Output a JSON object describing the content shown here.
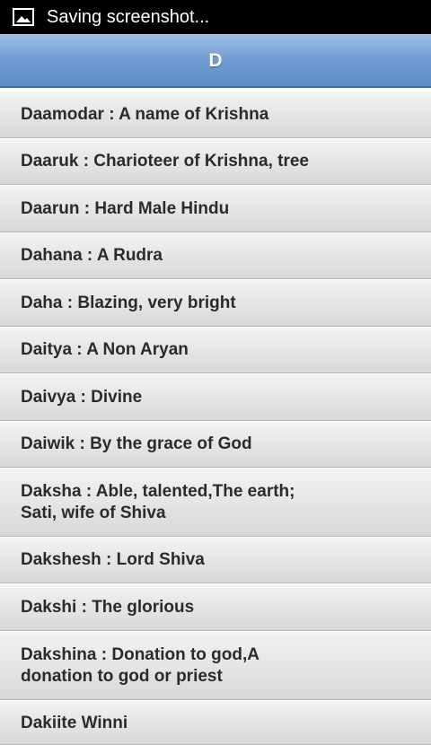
{
  "status_bar": {
    "text": "Saving screenshot...",
    "icon": "image-icon"
  },
  "header": {
    "title": "D"
  },
  "list": {
    "items": [
      {
        "text": "Daamodar : A name of Krishna"
      },
      {
        "text": "Daaruk : Charioteer of Krishna, tree"
      },
      {
        "text": "Daarun : Hard Male Hindu"
      },
      {
        "text": "Dahana : A Rudra"
      },
      {
        "text": "Daha : Blazing, very bright"
      },
      {
        "text": "Daitya : A Non Aryan"
      },
      {
        "text": "Daivya : Divine"
      },
      {
        "text": "Daiwik : By the grace of God"
      },
      {
        "text": "Daksha : Able, talented,The earth;\nSati, wife of Shiva"
      },
      {
        "text": "Dakshesh : Lord Shiva"
      },
      {
        "text": "Dakshi : The glorious"
      },
      {
        "text": "Dakshina : Donation to god,A\ndonation to god or priest"
      },
      {
        "text": "Dakiite Winni"
      }
    ]
  },
  "colors": {
    "header_gradient_top": "#9bbde3",
    "header_gradient_bottom": "#5c8cc6",
    "item_text": "#2b2b2b",
    "status_bar_bg": "#000000"
  }
}
